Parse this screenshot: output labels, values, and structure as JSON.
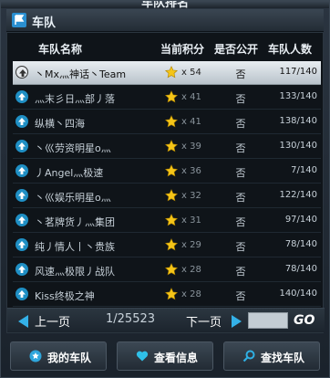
{
  "window": {
    "top_title": "车队排名"
  },
  "header": {
    "title": "车队"
  },
  "columns": {
    "name": "车队名称",
    "score": "当前积分",
    "public": "是否公开",
    "count": "车队人数"
  },
  "rows": [
    {
      "name": "丶Mx灬神话丶Team",
      "score": "x 54",
      "public": "否",
      "count": "117/140"
    },
    {
      "name": "灬末彡日灬部丿落",
      "score": "x 41",
      "public": "否",
      "count": "133/140"
    },
    {
      "name": "纵横丶四海",
      "score": "x 41",
      "public": "否",
      "count": "138/140"
    },
    {
      "name": "丶巛劳资明星o灬",
      "score": "x 39",
      "public": "否",
      "count": "130/140"
    },
    {
      "name": "丿Angel灬极速",
      "score": "x 36",
      "public": "否",
      "count": "7/140"
    },
    {
      "name": "丶巛娱乐明星o灬",
      "score": "x 32",
      "public": "否",
      "count": "122/140"
    },
    {
      "name": "丶茗牌货丿灬集团",
      "score": "x 31",
      "public": "否",
      "count": "97/140"
    },
    {
      "name": "纯丿情人丨丶贵族",
      "score": "x 29",
      "public": "否",
      "count": "78/140"
    },
    {
      "name": "风速灬极限丿战队",
      "score": "x 28",
      "public": "否",
      "count": "78/140"
    },
    {
      "name": "Kiss终极之神",
      "score": "x 28",
      "public": "否",
      "count": "140/140"
    }
  ],
  "pager": {
    "prev": "上一页",
    "page_info": "1/25523",
    "next": "下一页",
    "go": "GO",
    "page_input": ""
  },
  "footer": {
    "my_team": "我的车队",
    "view_info": "查看信息",
    "find_team": "查找车队"
  },
  "colors": {
    "accent": "#34b1e8",
    "star": "#f5c518",
    "selected_row": "#d9e0e6"
  }
}
